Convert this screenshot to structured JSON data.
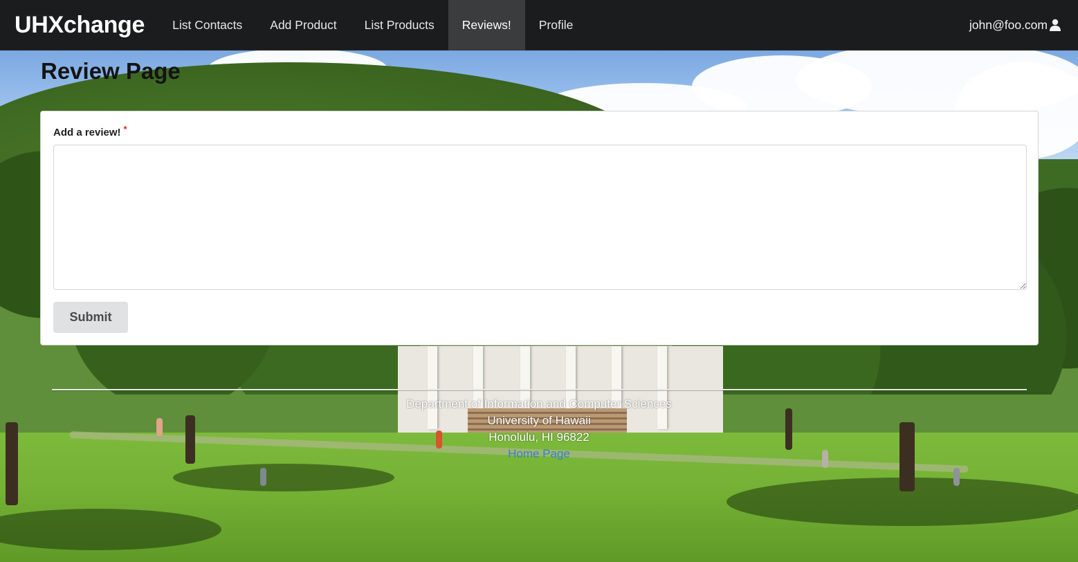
{
  "navbar": {
    "brand": "UHXchange",
    "items": [
      {
        "label": "List Contacts",
        "active": false
      },
      {
        "label": "Add Product",
        "active": false
      },
      {
        "label": "List Products",
        "active": false
      },
      {
        "label": "Reviews!",
        "active": true
      },
      {
        "label": "Profile",
        "active": false
      }
    ],
    "user": {
      "email": "john@foo.com",
      "icon": "user-icon"
    }
  },
  "main": {
    "title": "Review Page",
    "form": {
      "review_label": "Add a review!",
      "required_marker": "*",
      "review_value": "",
      "submit_label": "Submit"
    }
  },
  "footer": {
    "line1": "Department of Information and Computer Sciences",
    "line2": "University of Hawaii",
    "line3": "Honolulu, HI 96822",
    "link": "Home Page"
  },
  "colors": {
    "navbar_bg": "#1b1c1d",
    "active_nav_bg": "#3b3c3d",
    "required": "#db2828",
    "link": "#3a7fd0",
    "button_bg": "#e0e1e2"
  }
}
